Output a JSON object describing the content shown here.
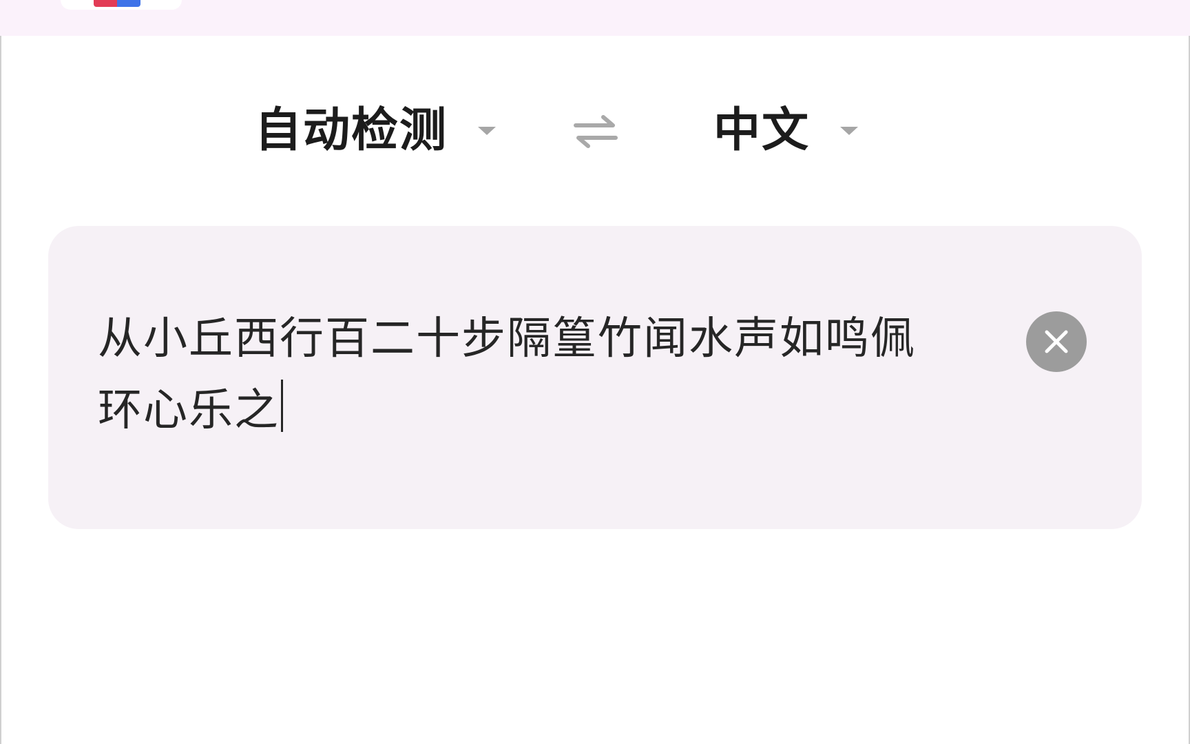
{
  "language_bar": {
    "source_language": "自动检测",
    "target_language": "中文",
    "swap_icon": "swap-arrows-icon",
    "dropdown_icon": "caret-down-icon"
  },
  "input": {
    "text": "从小丘西行百二十步隔篁竹闻水声如鸣佩环心乐之",
    "clear_icon": "close-circle-icon"
  },
  "colors": {
    "top_bar": "#fbf2fb",
    "card_background": "#f6f1f6",
    "text": "#262626",
    "clear_button": "#9c9c9c",
    "caret": "#a6a6a6"
  }
}
